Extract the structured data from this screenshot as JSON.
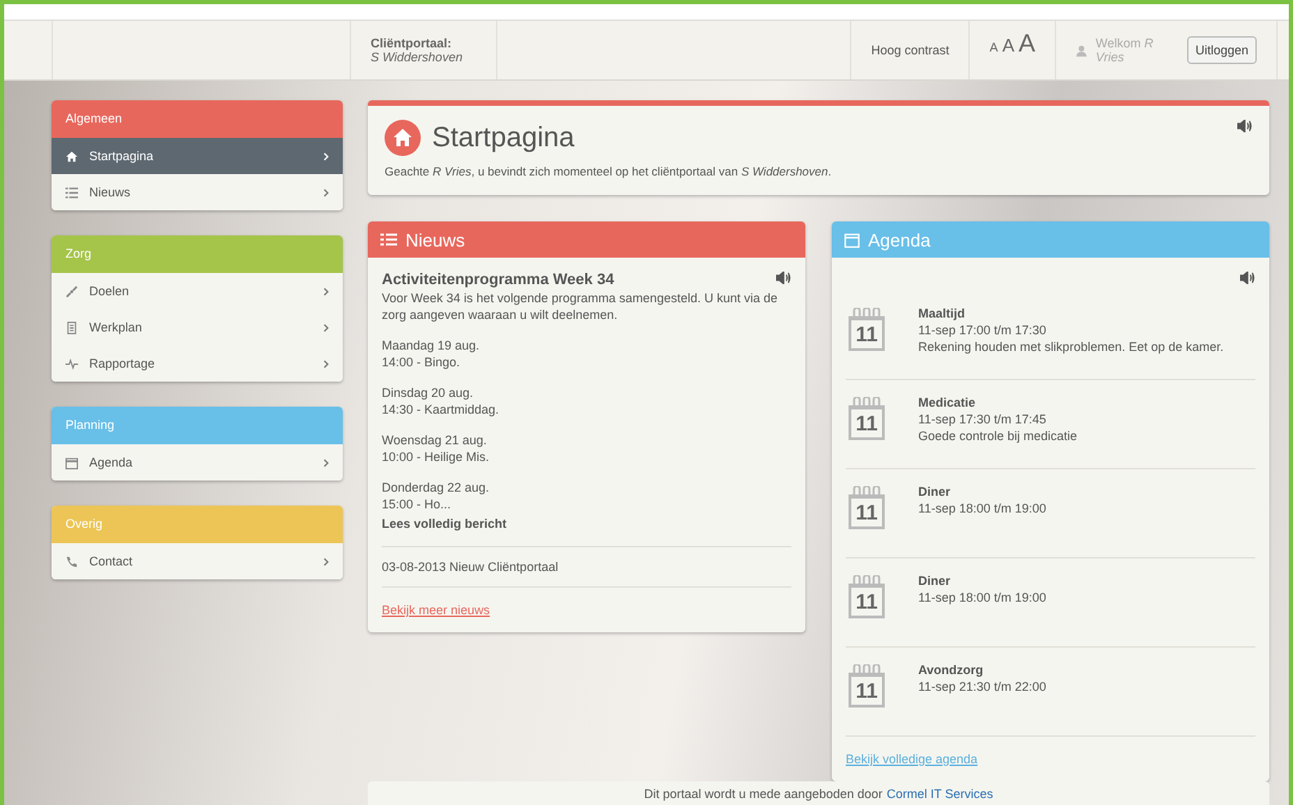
{
  "header": {
    "portal_label": "Cliëntportaal:",
    "portal_client": "S Widdershoven",
    "contrast": "Hoog contrast",
    "font_sizes": [
      "A",
      "A",
      "A"
    ],
    "welcome": "Welkom *R Vries*",
    "logout": "Uitloggen"
  },
  "sidebar": [
    {
      "title": "Algemeen",
      "color": "#e8675c",
      "items": [
        {
          "label": "Startpagina",
          "kind": "home",
          "selected": true
        },
        {
          "label": "Nieuws",
          "kind": "list",
          "selected": false
        }
      ]
    },
    {
      "title": "Zorg",
      "color": "#a5c44a",
      "items": [
        {
          "label": "Doelen",
          "kind": "link",
          "selected": false
        },
        {
          "label": "Werkplan",
          "kind": "document",
          "selected": false
        },
        {
          "label": "Rapportage",
          "kind": "pulse",
          "selected": false
        }
      ]
    },
    {
      "title": "Planning",
      "color": "#68bfe8",
      "items": [
        {
          "label": "Agenda",
          "kind": "calendar",
          "selected": false
        }
      ]
    },
    {
      "title": "Overig",
      "color": "#ecc556",
      "items": [
        {
          "label": "Contact",
          "kind": "phone",
          "selected": false
        }
      ]
    }
  ],
  "start": {
    "title": "Startpagina",
    "greeting": "Geachte *R Vries*, u bevindt zich momenteel op het cliëntportaal van *S Widdershoven*."
  },
  "news": {
    "title": "Nieuws",
    "article_title": "Activiteitenprogramma Week 34",
    "intro": "Voor Week 34 is het volgende programma samengesteld. U kunt via de zorg aangeven waaraan u wilt deelnemen.",
    "days": [
      {
        "day": "Maandag 19 aug.",
        "event": "14:00 - Bingo."
      },
      {
        "day": "Dinsdag 20 aug.",
        "event": "14:30 - Kaartmiddag."
      },
      {
        "day": "Woensdag 21 aug.",
        "event": "10:00 - Heilige Mis."
      },
      {
        "day": "Donderdag 22 aug.",
        "event": "15:00 - Ho..."
      }
    ],
    "read_more": "Lees volledig bericht",
    "other": "03-08-2013 Nieuw Cliëntportaal",
    "more_link": "Bekijk meer nieuws"
  },
  "agenda": {
    "title": "Agenda",
    "items": [
      {
        "day": "11",
        "title": "Maaltijd",
        "time": "11-sep 17:00 t/m 17:30",
        "note": "Rekening houden met slikproblemen. Eet op de kamer."
      },
      {
        "day": "11",
        "title": "Medicatie",
        "time": "11-sep 17:30 t/m 17:45",
        "note": "Goede controle bij medicatie"
      },
      {
        "day": "11",
        "title": "Diner",
        "time": "11-sep 18:00 t/m 19:00"
      },
      {
        "day": "11",
        "title": "Diner",
        "time": "11-sep 18:00 t/m 19:00"
      },
      {
        "day": "11",
        "title": "Avondzorg",
        "time": "11-sep 21:30 t/m 22:00"
      }
    ],
    "more_link": "Bekijk volledige agenda"
  },
  "footer": {
    "text": "Dit portaal wordt u mede aangeboden door",
    "link": "Cormel IT Services"
  }
}
